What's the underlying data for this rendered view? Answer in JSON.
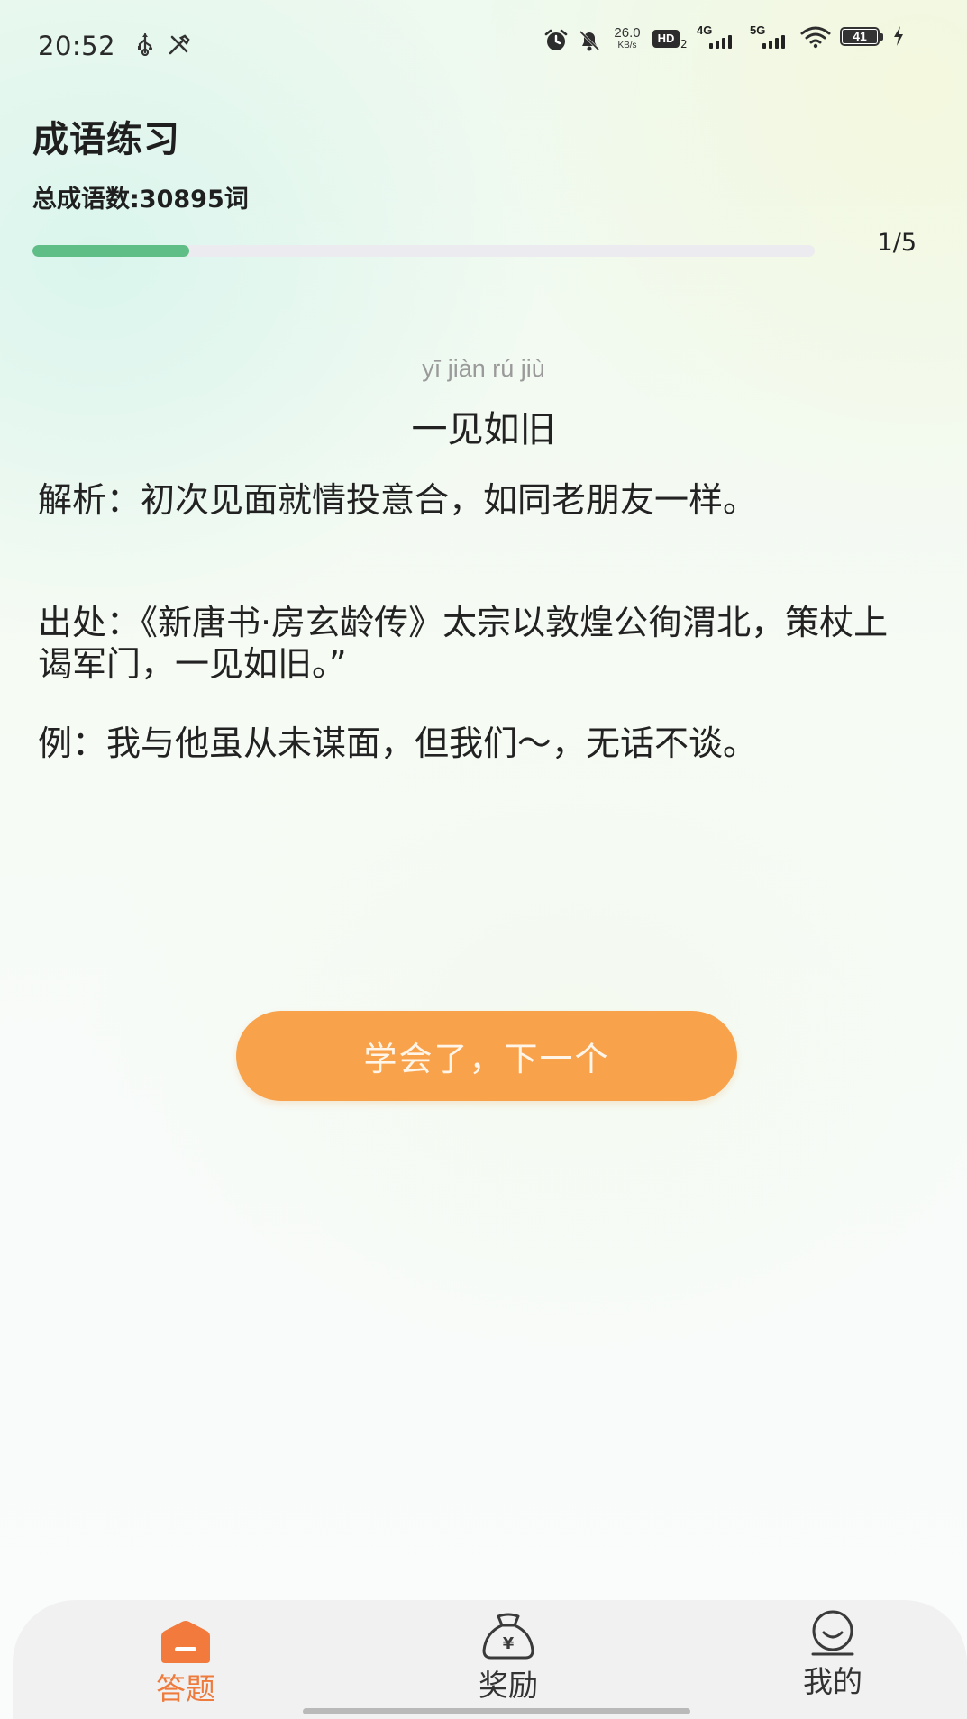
{
  "status_bar": {
    "time": "20:52",
    "icons": [
      "usb-icon",
      "tools-icon",
      "alarm-icon",
      "bell-off-icon"
    ],
    "net_speed_value": "26.0",
    "net_speed_unit": "KB/s",
    "hd_label": "HD",
    "hd_sub": "2",
    "signal_1_label": "4G",
    "signal_2_label": "5G",
    "battery": "41"
  },
  "header": {
    "title": "成语练习",
    "total_count": "总成语数:30895词",
    "progress_text": "1/5",
    "progress_fraction": 0.2
  },
  "idiom": {
    "pinyin": "yī jiàn rú jiù",
    "text": "一见如旧",
    "explanation_label": "解析：",
    "explanation": "初次见面就情投意合，如同老朋友一样。",
    "source_label": "出处：",
    "source": "《新唐书·房玄龄传》太宗以敦煌公徇渭北，策杖上谒军门，一见如旧。”",
    "example_label": "例：",
    "example": "我与他虽从未谋面，但我们～，无话不谈。"
  },
  "next_button": "学会了，下一个",
  "bottom_nav": {
    "items": [
      {
        "label": "答题",
        "icon": "home-icon",
        "active": true
      },
      {
        "label": "奖励",
        "icon": "money-bag-icon",
        "active": false
      },
      {
        "label": "我的",
        "icon": "smiley-icon",
        "active": false
      }
    ]
  },
  "colors": {
    "accent_orange": "#f8a24c",
    "active_tab": "#ee7a3c",
    "progress_green": "#5fbd86"
  }
}
